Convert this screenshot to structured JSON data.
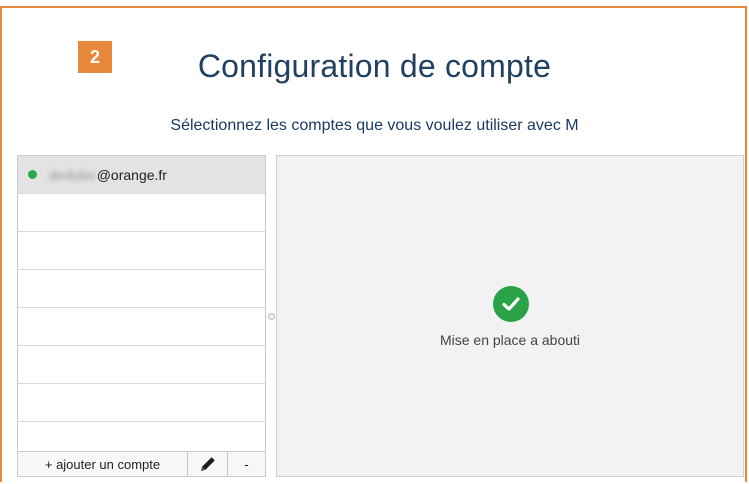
{
  "step": {
    "number": "2"
  },
  "header": {
    "title": "Configuration de compte",
    "subtitle": "Sélectionnez les comptes que vous voulez utiliser avec M"
  },
  "accounts": {
    "items": [
      {
        "name_blurred": "dedubo",
        "domain": "@orange.fr",
        "status": "connected"
      }
    ],
    "empty_rows": 7
  },
  "toolbar": {
    "add_label": "+ ajouter un compte",
    "edit_icon": "pencil-icon",
    "remove_label": "-"
  },
  "detail": {
    "status_icon": "check-circle-icon",
    "status_text": "Mise en place a abouti"
  },
  "colors": {
    "accent": "#e8883a",
    "title": "#22405f",
    "success": "#27a84a"
  }
}
